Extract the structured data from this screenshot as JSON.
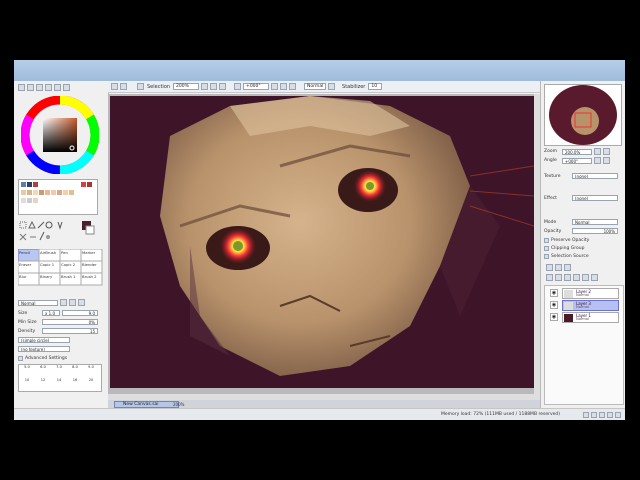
{
  "toolbar": {
    "selection_label": "Selection",
    "zoom_value": "200%",
    "rotation_value": "+000°",
    "blend_mode": "Normal",
    "stabilizer_label": "Stabilizer",
    "stabilizer_value": "10"
  },
  "tool_options": {
    "mode_value": "Normal",
    "size_label": "Size",
    "size_value": "x 1.0",
    "size_number": "9.0",
    "min_size_label": "Min Size",
    "min_size_value": "0%",
    "density_label": "Density",
    "density_value": "15",
    "circle_value": "(simple circle)",
    "texture_value": "(no texture)",
    "advanced_label": "Advanced Settings"
  },
  "brushes": {
    "row1": [
      "Pencil",
      "AirBrush",
      "Pen",
      "Marker"
    ],
    "row2": [
      "Eraser",
      "Copic 1",
      "Copic 2",
      "Blender"
    ],
    "row3": [
      "Blur",
      "Binary",
      "Brush 1",
      "Brush 2"
    ]
  },
  "brush_sizes": [
    "5.0",
    "6.0",
    "7.0",
    "8.0",
    "9.0",
    "10",
    "12",
    "14",
    "16",
    "20"
  ],
  "document": {
    "tab_label": "New Canvas.sai",
    "zoom": "200%"
  },
  "navigator": {
    "zoom_label": "Zoom",
    "zoom_value": "200.0%",
    "angle_label": "Angle",
    "angle_value": "+000°"
  },
  "layer_props": {
    "texture_label": "Texture",
    "texture_value": "(none)",
    "effect_label": "Effect",
    "effect_value": "(none)",
    "mode_label": "Mode",
    "mode_value": "Normal",
    "opacity_label": "Opacity",
    "opacity_value": "100%",
    "preserve_opacity": "Preserve Opacity",
    "clipping_group": "Clipping Group",
    "selection_source": "Selection Source"
  },
  "layers": [
    {
      "name": "Layer 2",
      "mode": "Normal",
      "opacity": "100%",
      "selected": false
    },
    {
      "name": "Layer 3",
      "mode": "Normal",
      "opacity": "100%",
      "selected": true
    },
    {
      "name": "Layer 1",
      "mode": "Normal",
      "opacity": "100%",
      "selected": false
    }
  ],
  "status": {
    "memory": "Memory load: 72% (111MB used / 1188MB reserved)"
  },
  "colors": {
    "canvas_bg": "#3d1428",
    "skin": "#c9a27c",
    "eye_glow": "#ff4a2a",
    "panel_bg": "#f0f0f0",
    "selected_layer": "#b7c0f2"
  }
}
